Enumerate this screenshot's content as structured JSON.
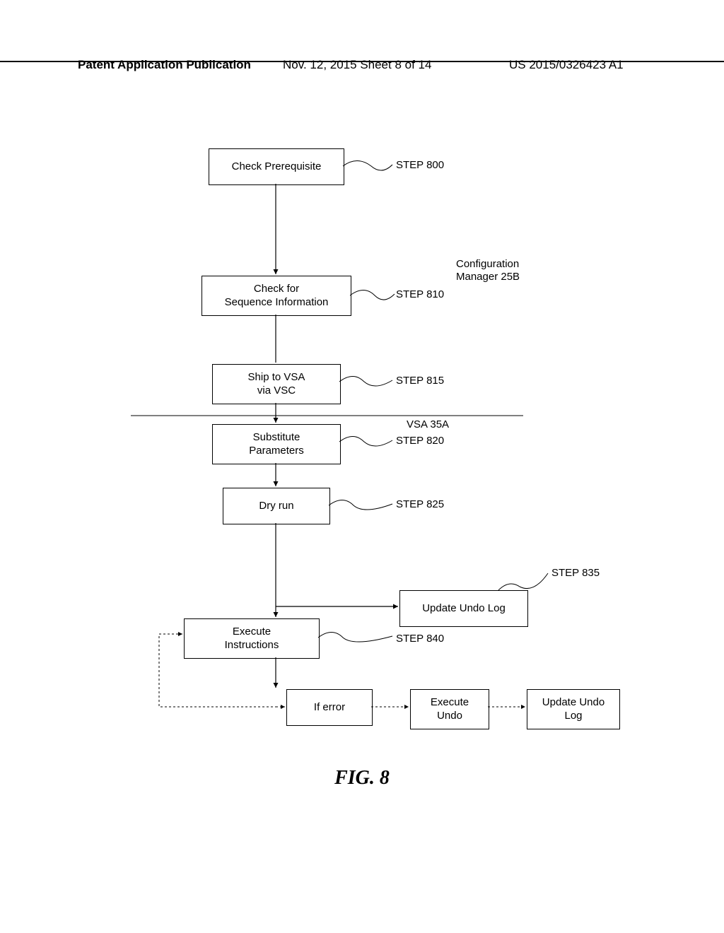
{
  "header": {
    "left": "Patent Application Publication",
    "mid": "Nov. 12, 2015  Sheet 8 of 14",
    "right": "US 2015/0326423 A1"
  },
  "boxes": {
    "b800": "Check Prerequisite",
    "b810_l1": "Check for",
    "b810_l2": "Sequence Information",
    "b815_l1": "Ship to VSA",
    "b815_l2": "via VSC",
    "b820_l1": "Substitute",
    "b820_l2": "Parameters",
    "b825": "Dry run",
    "b835": "Update Undo Log",
    "b840_l1": "Execute",
    "b840_l2": "Instructions",
    "bErr": "If error",
    "bExecUndo_l1": "Execute",
    "bExecUndo_l2": "Undo",
    "bUpdateUndo_l1": "Update Undo",
    "bUpdateUndo_l2": "Log"
  },
  "labels": {
    "s800": "STEP 800",
    "s810": "STEP 810",
    "s815": "STEP 815",
    "s820": "STEP 820",
    "s825": "STEP 825",
    "s835": "STEP 835",
    "s840": "STEP 840",
    "cfgMgr_l1": "Configuration",
    "cfgMgr_l2": "Manager 25B",
    "vsa": "VSA 35A"
  },
  "caption": "FIG. 8"
}
